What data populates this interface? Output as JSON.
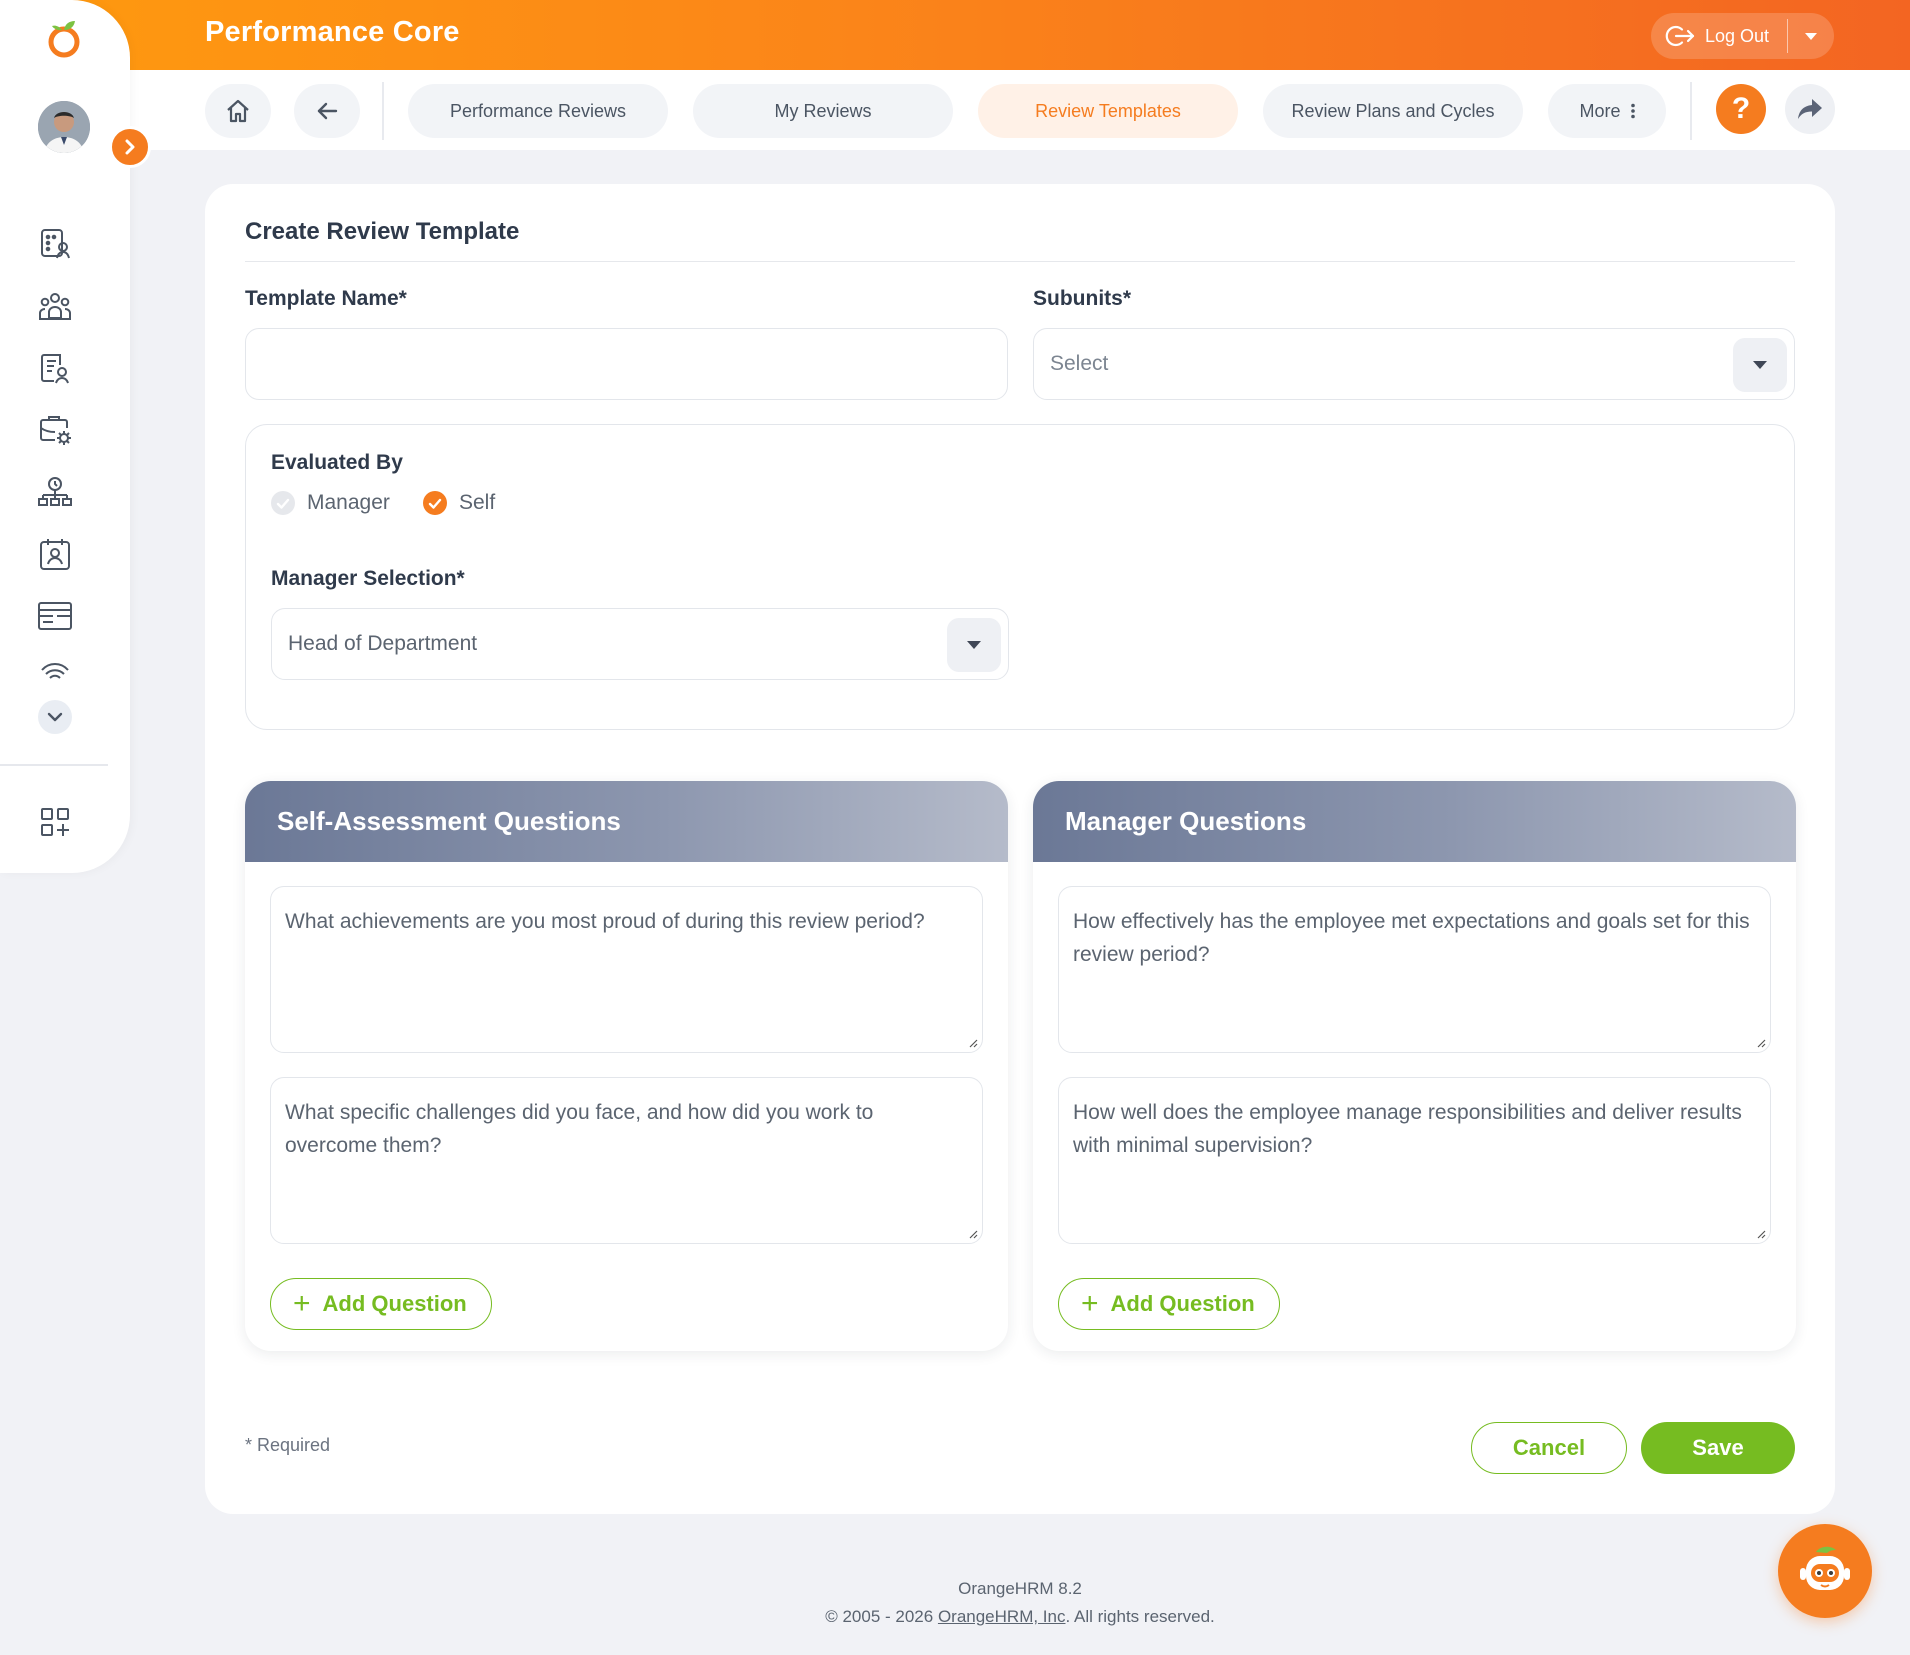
{
  "app": {
    "title": "Performance Core"
  },
  "header": {
    "logout_label": "Log Out"
  },
  "nav": {
    "tabs": [
      {
        "label": "Performance Reviews",
        "active": false
      },
      {
        "label": "My Reviews",
        "active": false
      },
      {
        "label": "Review Templates",
        "active": true
      },
      {
        "label": "Review Plans and Cycles",
        "active": false
      },
      {
        "label": "More",
        "active": false
      }
    ],
    "help_label": "?"
  },
  "sidebar": {
    "icons": [
      "directory-icon",
      "people-icon",
      "reports-icon",
      "settings-suitcase-icon",
      "time-org-icon",
      "calendar-person-icon",
      "card-icon",
      "fingerprint-icon"
    ]
  },
  "form": {
    "title": "Create Review Template",
    "template_name_label": "Template Name*",
    "template_name_value": "",
    "subunits_label": "Subunits*",
    "subunits_placeholder": "Select",
    "evaluated_by_label": "Evaluated By",
    "evaluators": [
      {
        "label": "Manager",
        "checked": true,
        "disabled": true
      },
      {
        "label": "Self",
        "checked": true,
        "disabled": false
      }
    ],
    "manager_selection_label": "Manager Selection*",
    "manager_selection_value": "Head of Department",
    "required_note": "* Required",
    "cancel_label": "Cancel",
    "save_label": "Save"
  },
  "self_assessment": {
    "title": "Self-Assessment Questions",
    "questions": [
      "What achievements are you most proud of during this review period?",
      "What specific challenges did you face, and how did you work to overcome them?"
    ],
    "add_label": "Add Question"
  },
  "manager_questions": {
    "title": "Manager Questions",
    "questions": [
      "How effectively has the employee met expectations and goals set for this review period?",
      "How well does the employee manage responsibilities and deliver results with minimal supervision?"
    ],
    "add_label": "Add Question"
  },
  "footer": {
    "version": "OrangeHRM 8.2",
    "copyright_prefix": "© 2005 - 2026 ",
    "company_link": "OrangeHRM, Inc",
    "copyright_suffix": ". All rights reserved."
  },
  "colors": {
    "brand_orange": "#f57c1f",
    "action_green": "#76bc21",
    "active_tab_bg": "#fff1e7"
  }
}
